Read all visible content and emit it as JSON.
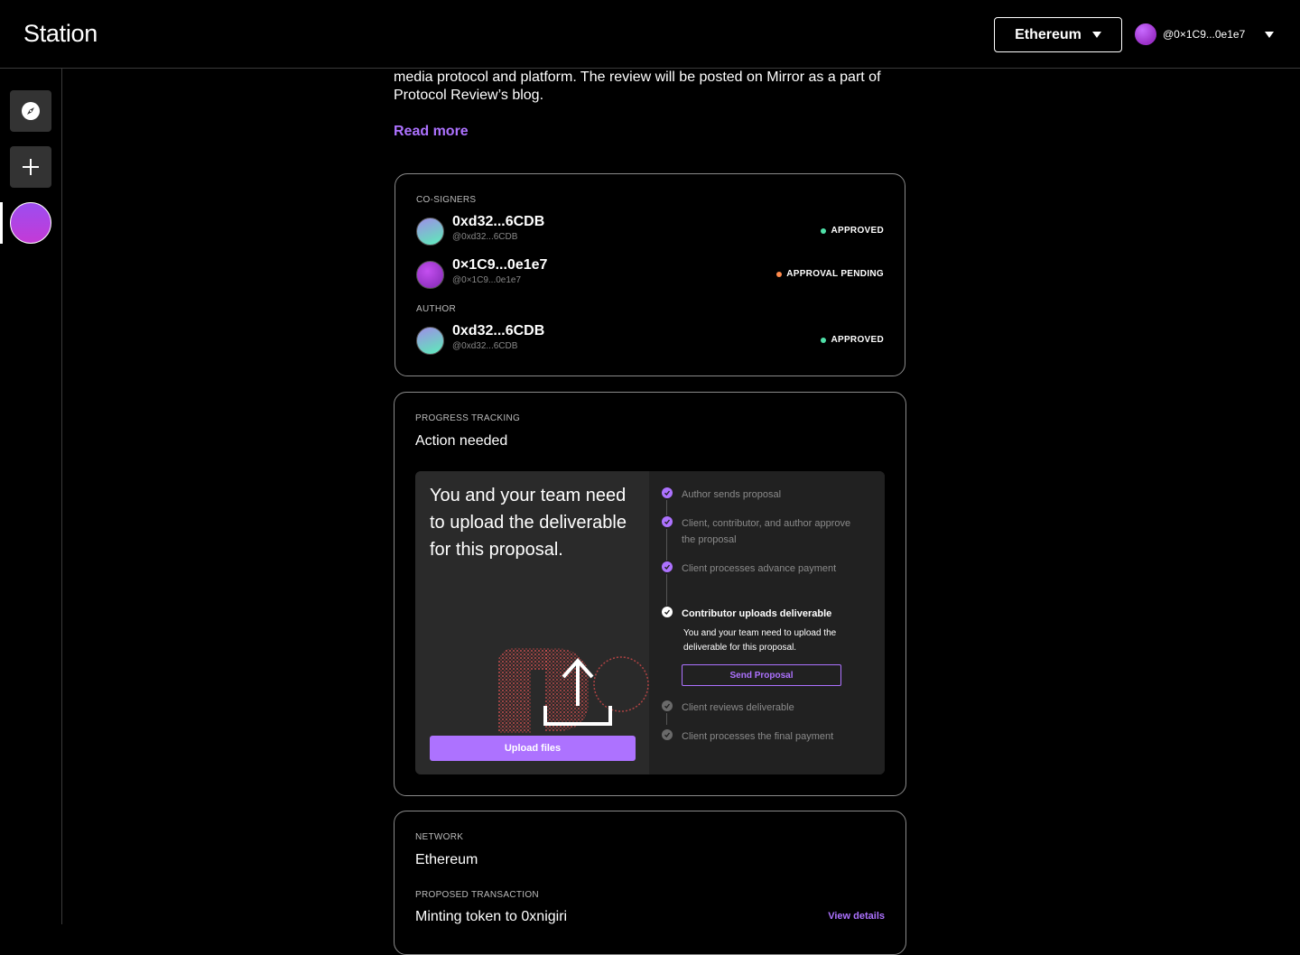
{
  "header": {
    "logo": "Station",
    "network_button": "Ethereum",
    "account_handle": "@0×1C9...0e1e7"
  },
  "sidebar": {
    "items": [
      {
        "name": "explore",
        "icon": "compass-icon"
      },
      {
        "name": "create",
        "icon": "plus-icon"
      },
      {
        "name": "profile",
        "icon": "avatar"
      }
    ]
  },
  "intro": {
    "text": "media protocol and platform. The review will be posted on Mirror as a part of Protocol Review’s blog.",
    "read_more": "Read more"
  },
  "cosigners_card": {
    "cosigners_label": "CO-SIGNERS",
    "cosigners": [
      {
        "name": "0xd32...6CDB",
        "handle": "@0xd32...6CDB",
        "status": "APPROVED",
        "status_color": "#4fe0a8"
      },
      {
        "name": "0×1C9...0e1e7",
        "handle": "@0×1C9...0e1e7",
        "status": "APPROVAL PENDING",
        "status_color": "#ff8a4c"
      }
    ],
    "author_label": "AUTHOR",
    "author": {
      "name": "0xd32...6CDB",
      "handle": "@0xd32...6CDB",
      "status": "APPROVED",
      "status_color": "#4fe0a8"
    }
  },
  "progress_card": {
    "label": "PROGRESS TRACKING",
    "status": "Action needed",
    "heading": "You and your team need to upload the deliverable for this proposal.",
    "upload_button": "Upload files",
    "steps": [
      {
        "text": "Author sends proposal",
        "state": "done"
      },
      {
        "text": "Client, contributor, and author approve the proposal",
        "state": "done"
      },
      {
        "text": "Client processes advance payment",
        "state": "done"
      },
      {
        "text": "Contributor uploads deliverable",
        "state": "current"
      },
      {
        "text": "Client reviews deliverable",
        "state": "todo"
      },
      {
        "text": "Client processes the final payment",
        "state": "todo"
      }
    ],
    "current_step_detail": "You and your team need to upload the deliverable for this proposal.",
    "send_button": "Send Proposal"
  },
  "network_card": {
    "network_label": "NETWORK",
    "network_value": "Ethereum",
    "transaction_label": "PROPOSED TRANSACTION",
    "transaction_value": "Minting token to 0xnigiri",
    "view_details": "View details"
  },
  "colors": {
    "accent": "#ad72ff",
    "approved": "#4fe0a8",
    "pending": "#ff8a4c"
  }
}
